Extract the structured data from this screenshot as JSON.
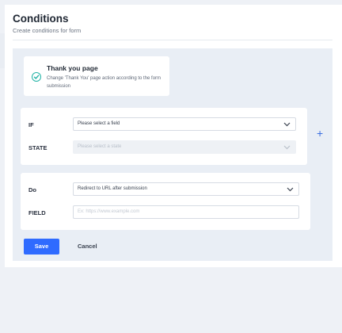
{
  "header": {
    "title": "Conditions",
    "subtitle": "Create conditions for form"
  },
  "thankyou_card": {
    "title": "Thank you page",
    "description": "Change 'Thank You' page action according to the form submission"
  },
  "if_block": {
    "if_label": "IF",
    "field_select_value": "Please select a field",
    "state_label": "STATE",
    "state_select_value": "Please select a state"
  },
  "do_block": {
    "do_label": "Do",
    "action_select_value": "Redirect to URL after submission",
    "field_label": "FIELD",
    "url_placeholder": "Ex: https://www.example.com"
  },
  "actions": {
    "save_label": "Save",
    "cancel_label": "Cancel",
    "add_icon": "plus-icon"
  },
  "colors": {
    "accent": "#2f6bff",
    "check": "#22b3a6"
  }
}
